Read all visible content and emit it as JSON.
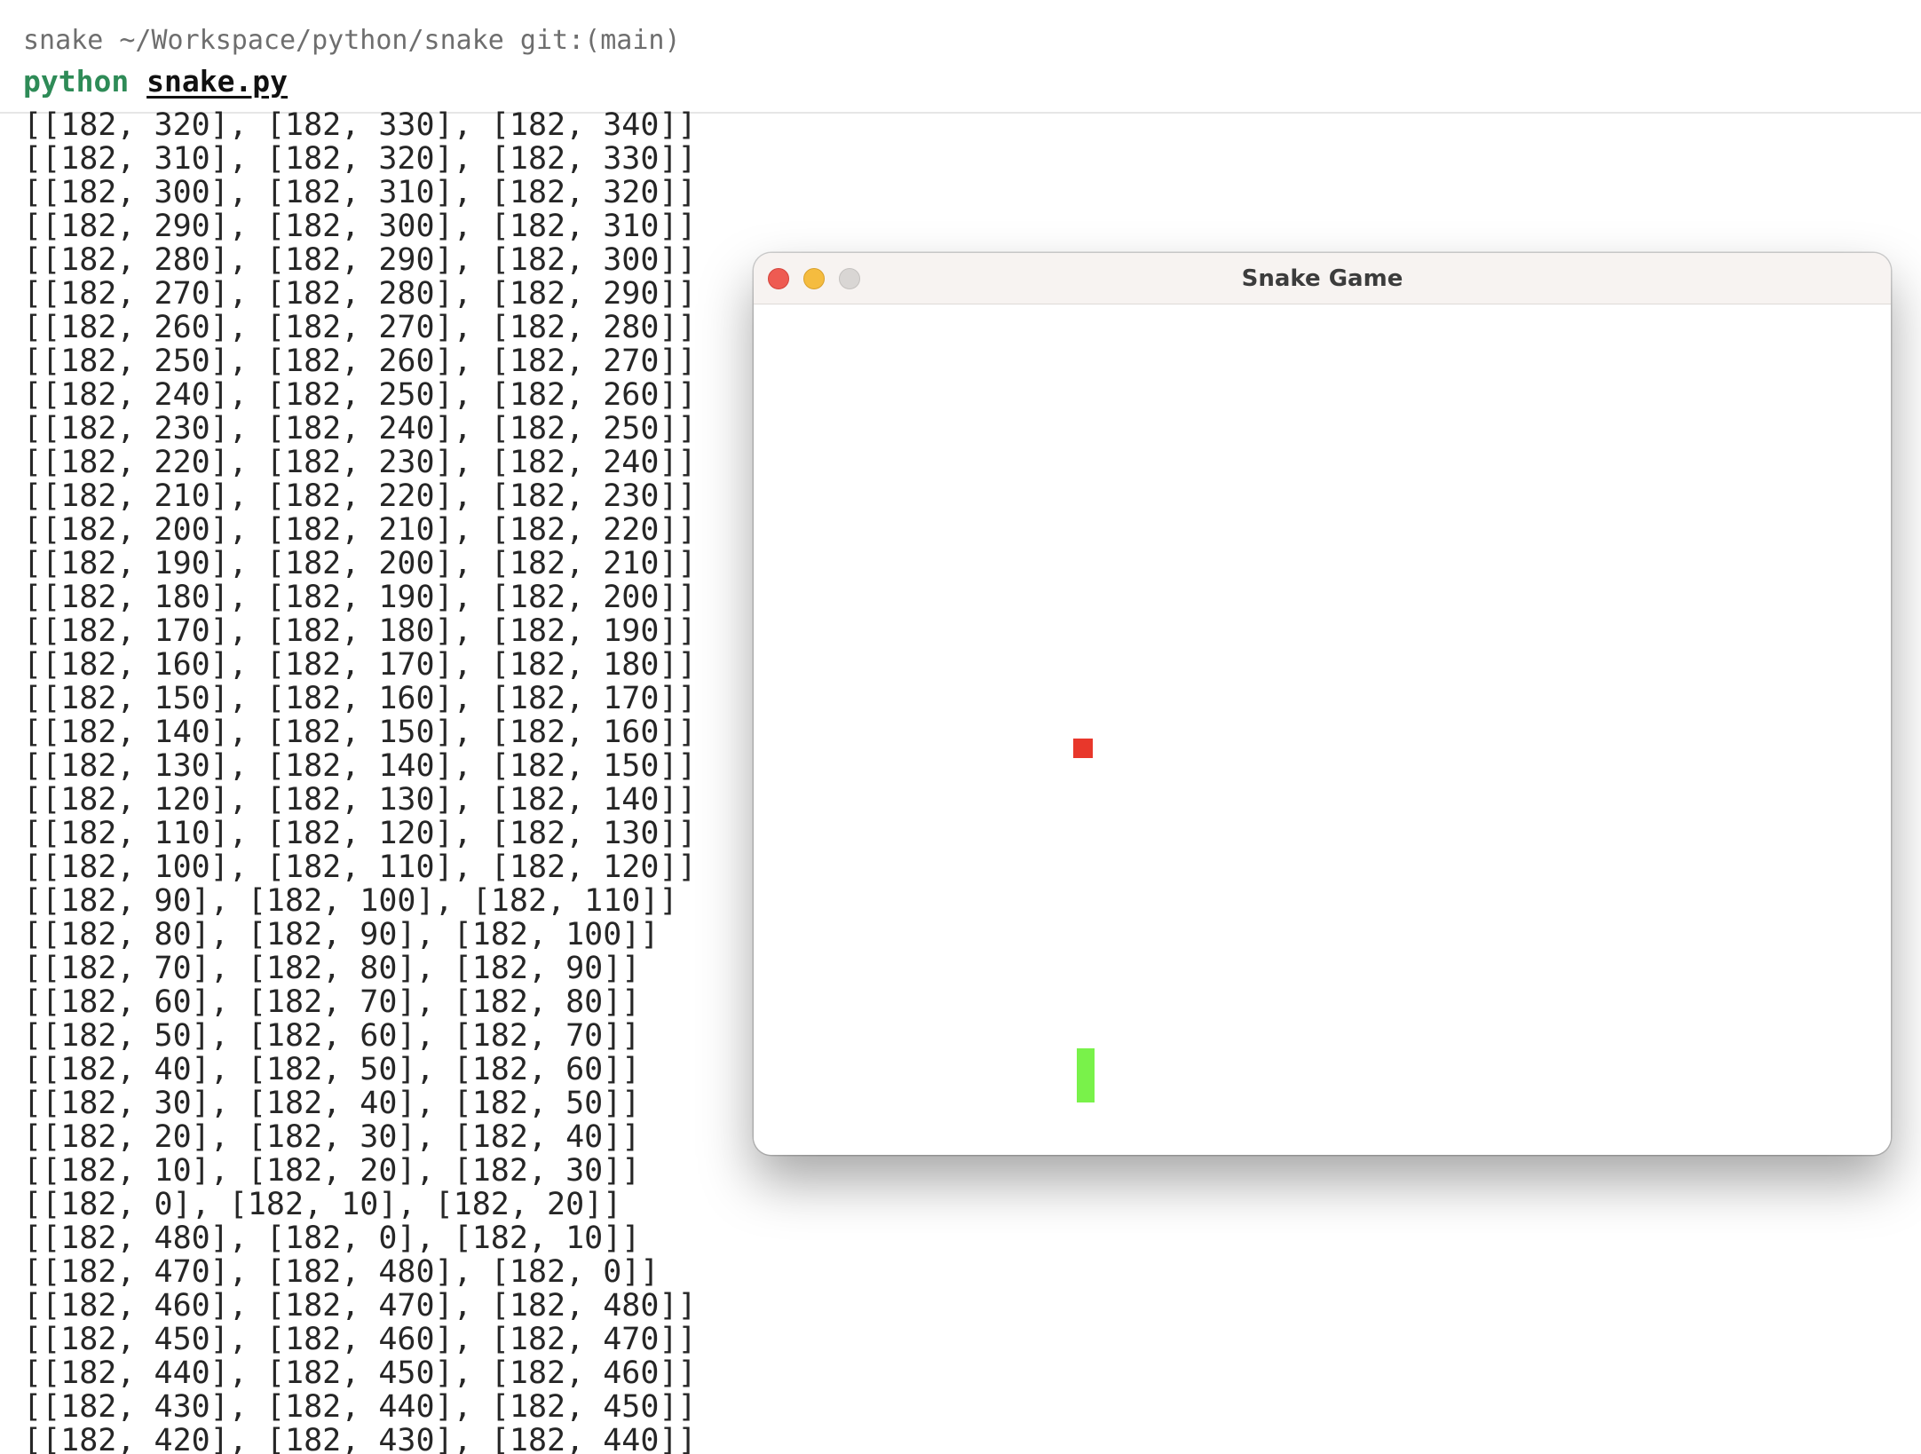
{
  "terminal": {
    "cwd_line": "snake ~/Workspace/python/snake git:(main)",
    "command": "python",
    "argument": "snake.py",
    "output_lines": [
      "[[182, 320], [182, 330], [182, 340]]",
      "[[182, 310], [182, 320], [182, 330]]",
      "[[182, 300], [182, 310], [182, 320]]",
      "[[182, 290], [182, 300], [182, 310]]",
      "[[182, 280], [182, 290], [182, 300]]",
      "[[182, 270], [182, 280], [182, 290]]",
      "[[182, 260], [182, 270], [182, 280]]",
      "[[182, 250], [182, 260], [182, 270]]",
      "[[182, 240], [182, 250], [182, 260]]",
      "[[182, 230], [182, 240], [182, 250]]",
      "[[182, 220], [182, 230], [182, 240]]",
      "[[182, 210], [182, 220], [182, 230]]",
      "[[182, 200], [182, 210], [182, 220]]",
      "[[182, 190], [182, 200], [182, 210]]",
      "[[182, 180], [182, 190], [182, 200]]",
      "[[182, 170], [182, 180], [182, 190]]",
      "[[182, 160], [182, 170], [182, 180]]",
      "[[182, 150], [182, 160], [182, 170]]",
      "[[182, 140], [182, 150], [182, 160]]",
      "[[182, 130], [182, 140], [182, 150]]",
      "[[182, 120], [182, 130], [182, 140]]",
      "[[182, 110], [182, 120], [182, 130]]",
      "[[182, 100], [182, 110], [182, 120]]",
      "[[182, 90], [182, 100], [182, 110]]",
      "[[182, 80], [182, 90], [182, 100]]",
      "[[182, 70], [182, 80], [182, 90]]",
      "[[182, 60], [182, 70], [182, 80]]",
      "[[182, 50], [182, 60], [182, 70]]",
      "[[182, 40], [182, 50], [182, 60]]",
      "[[182, 30], [182, 40], [182, 50]]",
      "[[182, 20], [182, 30], [182, 40]]",
      "[[182, 10], [182, 20], [182, 30]]",
      "[[182, 0], [182, 10], [182, 20]]",
      "[[182, 480], [182, 0], [182, 10]]",
      "[[182, 470], [182, 480], [182, 0]]",
      "[[182, 460], [182, 470], [182, 480]]",
      "[[182, 450], [182, 460], [182, 470]]",
      "[[182, 440], [182, 450], [182, 460]]",
      "[[182, 430], [182, 440], [182, 450]]",
      "[[182, 420], [182, 430], [182, 440]]"
    ]
  },
  "game_window": {
    "title": "Snake Game",
    "food_color": "#e8372b",
    "snake_color": "#79f24a",
    "traffic_lights": {
      "close_color": "#ee5b52",
      "minimize_color": "#f5bc3f",
      "zoom_color": "#d9d6d4"
    }
  }
}
